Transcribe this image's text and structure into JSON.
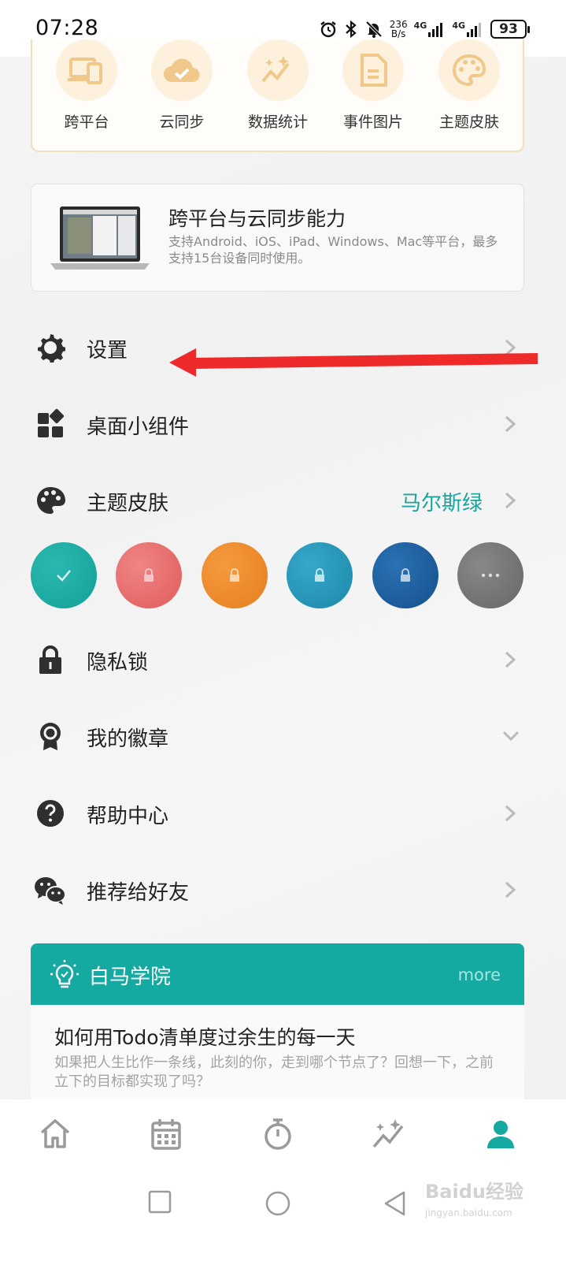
{
  "status_bar": {
    "time": "07:28",
    "net_speed_value": "236",
    "net_speed_unit": "B/s",
    "signal1_label": "4G",
    "signal2_label": "4G",
    "battery": "93"
  },
  "features": [
    {
      "label": "跨平台",
      "icon": "devices-icon"
    },
    {
      "label": "云同步",
      "icon": "cloud-check-icon"
    },
    {
      "label": "数据统计",
      "icon": "stats-sparkle-icon"
    },
    {
      "label": "事件图片",
      "icon": "document-icon"
    },
    {
      "label": "主题皮肤",
      "icon": "palette-icon"
    }
  ],
  "promo": {
    "title": "跨平台与云同步能力",
    "description": "支持Android、iOS、iPad、Windows、Mac等平台，最多支持15台设备同时使用。"
  },
  "menu": {
    "settings": "设置",
    "widgets": "桌面小组件",
    "theme": "主题皮肤",
    "theme_value": "马尔斯绿",
    "privacy": "隐私锁",
    "badges": "我的徽章",
    "help": "帮助中心",
    "share": "推荐给好友"
  },
  "theme_swatches": [
    {
      "color": "#1aa9a0",
      "state": "selected"
    },
    {
      "color": "#e86b6b",
      "state": "locked"
    },
    {
      "color": "#ee8a2a",
      "state": "locked"
    },
    {
      "color": "#2597b8",
      "state": "locked"
    },
    {
      "color": "#1e5f9e",
      "state": "locked"
    },
    {
      "color": "#777777",
      "state": "more"
    }
  ],
  "academy": {
    "title": "白马学院",
    "more": "more",
    "article_title": "如何用Todo清单度过余生的每一天",
    "article_desc": "如果把人生比作一条线，此刻的你，走到哪个节点了？回想一下，之前立下的目标都实现了吗？"
  },
  "bottom_tabs": [
    "home-icon",
    "calendar-icon",
    "timer-icon",
    "stats-icon",
    "profile-icon"
  ],
  "colors": {
    "accent": "#14aaa2",
    "feature_bg": "#fdf1de",
    "feature_icon": "#f0c98a",
    "annotation_arrow": "#ee2a2a"
  },
  "watermark": {
    "brand": "Baidu经验",
    "url": "jingyan.baidu.com"
  }
}
